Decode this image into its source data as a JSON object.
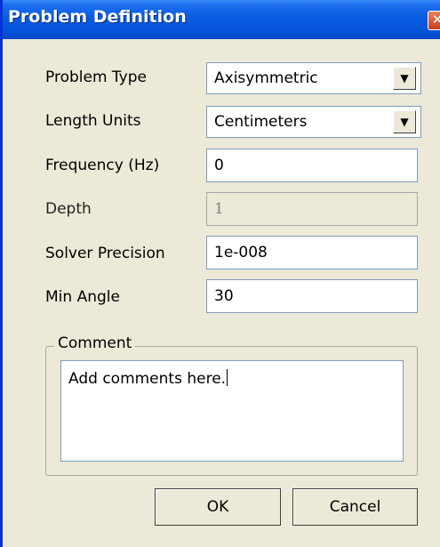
{
  "window": {
    "title": "Problem Definition",
    "close_icon": "close-icon"
  },
  "form": {
    "problem_type": {
      "label": "Problem Type",
      "value": "Axisymmetric"
    },
    "length_units": {
      "label": "Length Units",
      "value": "Centimeters"
    },
    "frequency": {
      "label": "Frequency (Hz)",
      "value": "0"
    },
    "depth": {
      "label": "Depth",
      "value": "1",
      "disabled": true
    },
    "solver_precision": {
      "label": "Solver Precision",
      "value": "1e-008"
    },
    "min_angle": {
      "label": "Min Angle",
      "value": "30"
    }
  },
  "comment": {
    "legend": "Comment",
    "value": "Add comments here."
  },
  "buttons": {
    "ok": "OK",
    "cancel": "Cancel"
  },
  "colors": {
    "titlebar": "#0a5ce0",
    "face": "#ece9d8",
    "close": "#d4542b"
  }
}
